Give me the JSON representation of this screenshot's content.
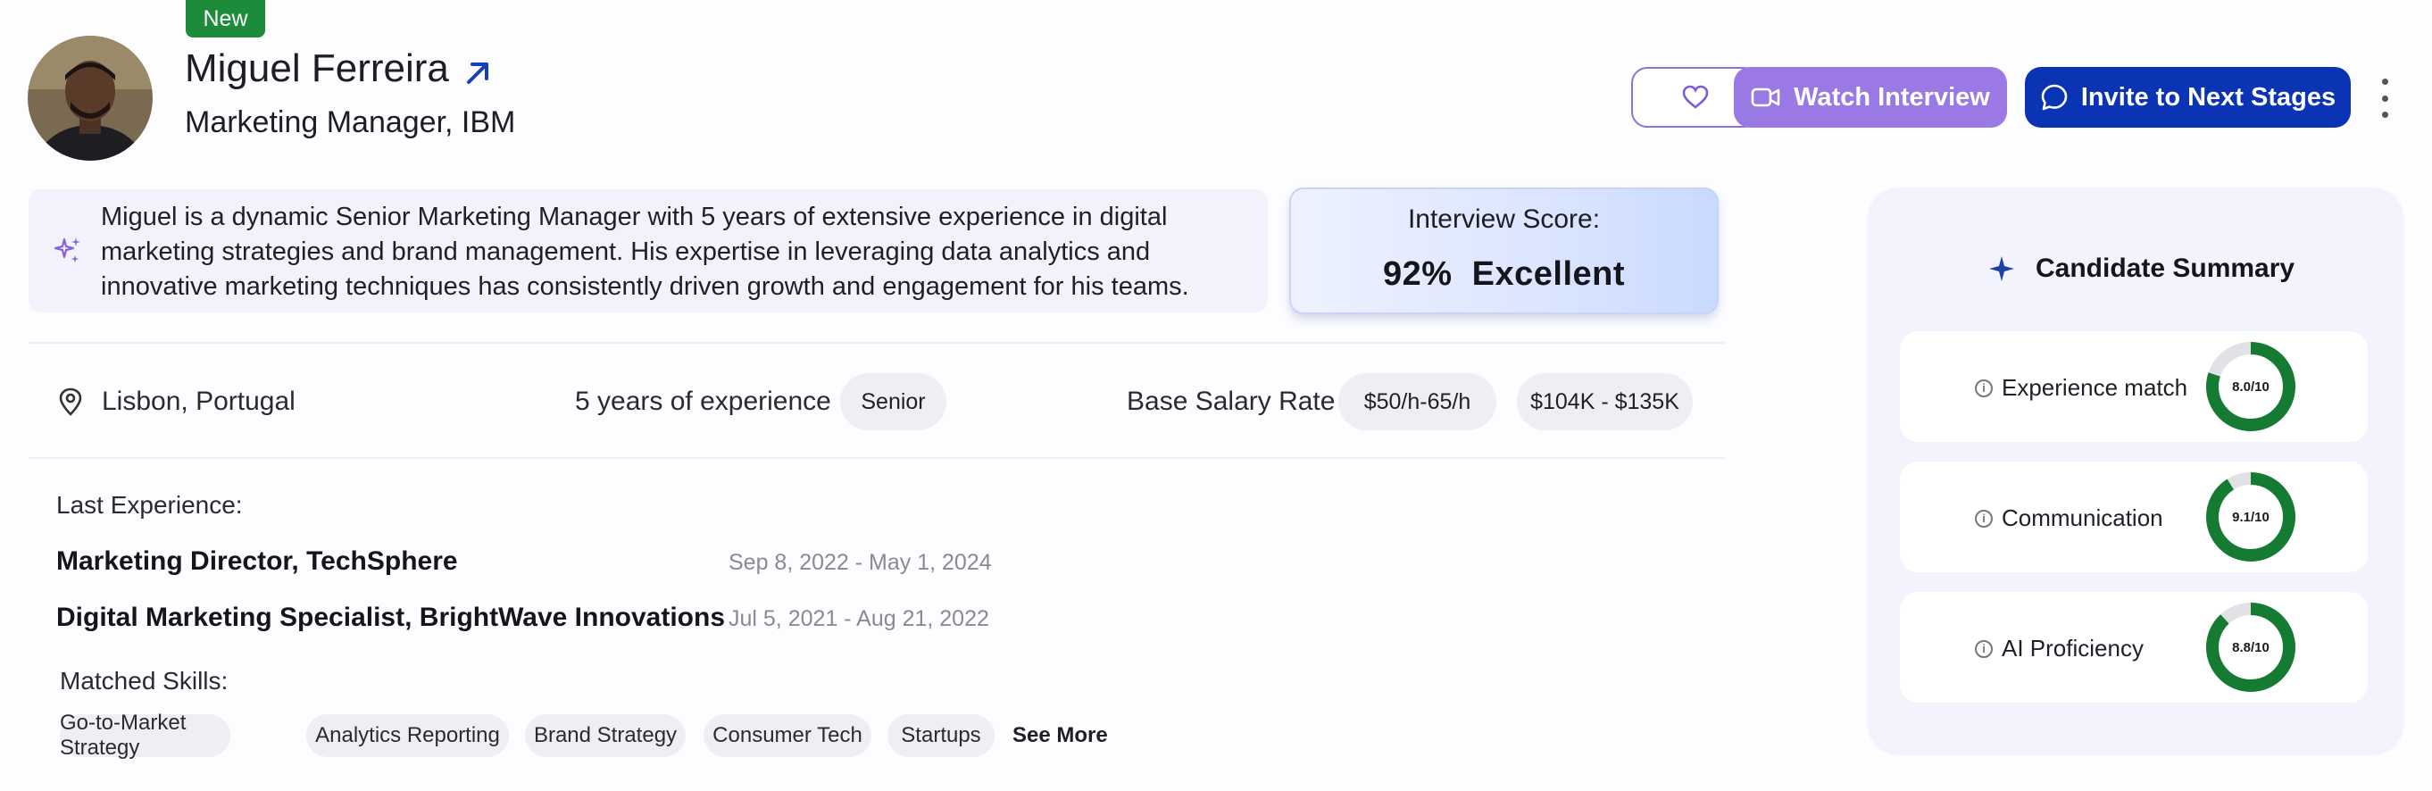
{
  "candidate": {
    "badge": "New",
    "name": "Miguel Ferreira",
    "role": "Marketing Manager, IBM",
    "bio": "Miguel is a dynamic Senior Marketing Manager with 5 years of extensive experience in digital marketing strategies and brand management. His expertise in leveraging data analytics and innovative marketing techniques has consistently driven growth and engagement for his teams."
  },
  "actions": {
    "watch_label": "Watch Interview",
    "invite_label": "Invite to Next Stages"
  },
  "score": {
    "label": "Interview Score:",
    "value": "92%",
    "rating": "Excellent"
  },
  "info": {
    "location": "Lisbon, Portugal",
    "experience": "5 years of experience",
    "level": "Senior",
    "salary_label": "Base Salary Rate",
    "hourly": "$50/h-65/h",
    "annual": "$104K - $135K"
  },
  "experience": {
    "label": "Last Experience:",
    "jobs": [
      {
        "title": "Marketing Director, TechSphere",
        "dates": "Sep 8, 2022 - May 1, 2024"
      },
      {
        "title": "Digital Marketing Specialist, BrightWave Innovations",
        "dates": "Jul 5, 2021 - Aug 21, 2022"
      }
    ]
  },
  "skills": {
    "label": "Matched Skills:",
    "items": [
      "Go-to-Market Strategy",
      "Analytics Reporting",
      "Brand Strategy",
      "Consumer Tech",
      "Startups"
    ],
    "see_more": "See More"
  },
  "summary": {
    "title": "Candidate Summary",
    "metrics": [
      {
        "label": "Experience match",
        "score_text": "8.0/10",
        "score": 8.0
      },
      {
        "label": "Communication",
        "score_text": "9.1/10",
        "score": 9.1
      },
      {
        "label": "AI Proficiency",
        "score_text": "8.8/10",
        "score": 8.8
      }
    ]
  },
  "colors": {
    "accent_green": "#1c8b3a",
    "watch_purple": "#9a79e4",
    "invite_blue": "#0a34b4",
    "donut_green": "#157a32",
    "donut_track": "#e2e2e6"
  }
}
